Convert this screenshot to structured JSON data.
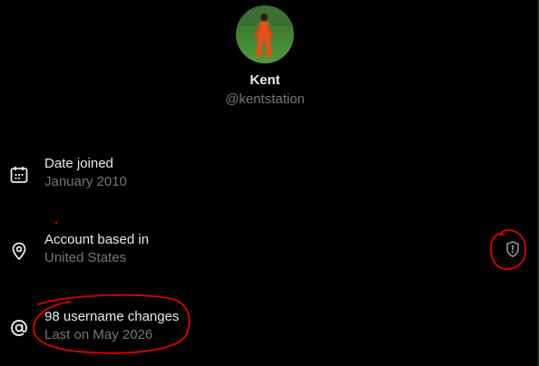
{
  "profile": {
    "name": "Kent",
    "handle": "@kentstation"
  },
  "rows": [
    {
      "icon": "calendar-icon",
      "title": "Date joined",
      "subtitle": "January 2010"
    },
    {
      "icon": "location-pin-icon",
      "title": "Account based in",
      "subtitle": "United States"
    },
    {
      "icon": "at-sign-icon",
      "title": "98 username changes",
      "subtitle": "Last on May 2026"
    }
  ],
  "colors": {
    "background": "#000000",
    "primary_text": "#e7e9ea",
    "secondary_text": "#71767b",
    "annotation": "#e00000"
  }
}
